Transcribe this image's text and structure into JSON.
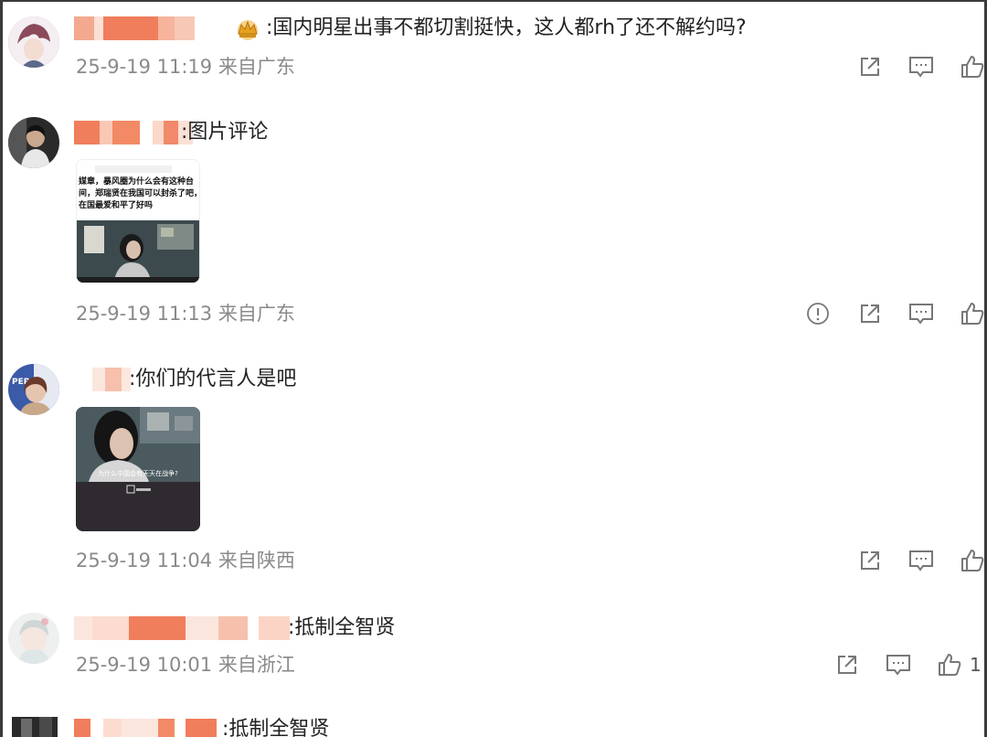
{
  "comments": [
    {
      "text": ":国内明星出事不都切割挺快，这人都rh了还不解约吗?",
      "meta": "25-9-19 11:19 来自广东"
    },
    {
      "text": ":图片评论",
      "meta": "25-9-19 11:13 来自广东",
      "image_lines": [
        "媒章，暴风圈为什么会有这种台",
        "间，郑瑞贤在我国可以封杀了吧，",
        "在国最爱和平了好吗"
      ]
    },
    {
      "text": ":你们的代言人是吧",
      "meta": "25-9-19 11:04 来自陕西",
      "image_caption": "为什么中国会有天天在战争?"
    },
    {
      "text": ":抵制全智贤",
      "meta": "25-9-19 10:01 来自浙江",
      "like_count": "1"
    },
    {
      "text": ":抵制全智贤"
    }
  ],
  "colors": {
    "meta_gray": "#8a8a8a",
    "icon_gray": "#777777",
    "redact_orange": "#f08a6a"
  }
}
